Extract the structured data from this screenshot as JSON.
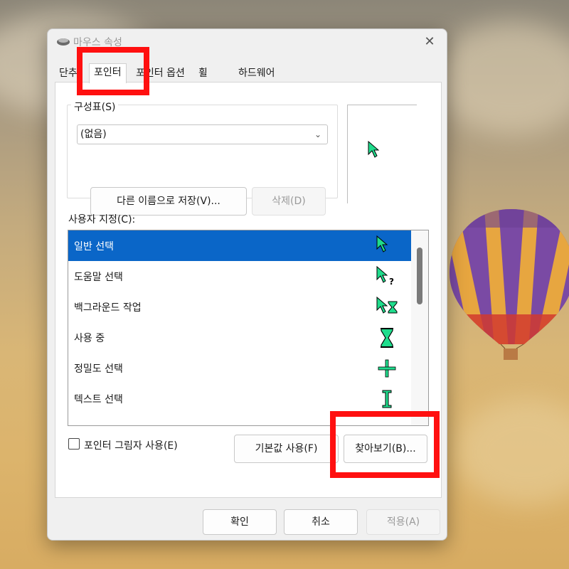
{
  "window": {
    "title": "마우스 속성",
    "close_glyph": "✕"
  },
  "tabs": [
    {
      "label": "단추"
    },
    {
      "label": "포인터"
    },
    {
      "label": "포인터 옵션"
    },
    {
      "label": "휠"
    },
    {
      "label": "하드웨어"
    }
  ],
  "scheme": {
    "group_label": "구성표(S)",
    "selected_value": "(없음)",
    "save_as_label": "다른 이름으로 저장(V)...",
    "delete_label": "삭제(D)"
  },
  "customize": {
    "label": "사용자 지정(C):",
    "items": [
      {
        "label": "일반 선택",
        "icon": "arrow-cursor-icon"
      },
      {
        "label": "도움말 선택",
        "icon": "help-cursor-icon"
      },
      {
        "label": "백그라운드 작업",
        "icon": "working-cursor-icon"
      },
      {
        "label": "사용 중",
        "icon": "busy-hourglass-icon"
      },
      {
        "label": "정밀도 선택",
        "icon": "precision-cross-icon"
      },
      {
        "label": "텍스트 선택",
        "icon": "text-beam-icon"
      }
    ]
  },
  "options": {
    "shadow_label": "포인터 그림자 사용(E)",
    "default_label": "기본값 사용(F)",
    "browse_label": "찾아보기(B)..."
  },
  "footer": {
    "ok_label": "확인",
    "cancel_label": "취소",
    "apply_label": "적용(A)"
  },
  "colors": {
    "cursor": "#1fdc8c",
    "selection": "#0a66c8",
    "highlight": "#ff1010"
  }
}
